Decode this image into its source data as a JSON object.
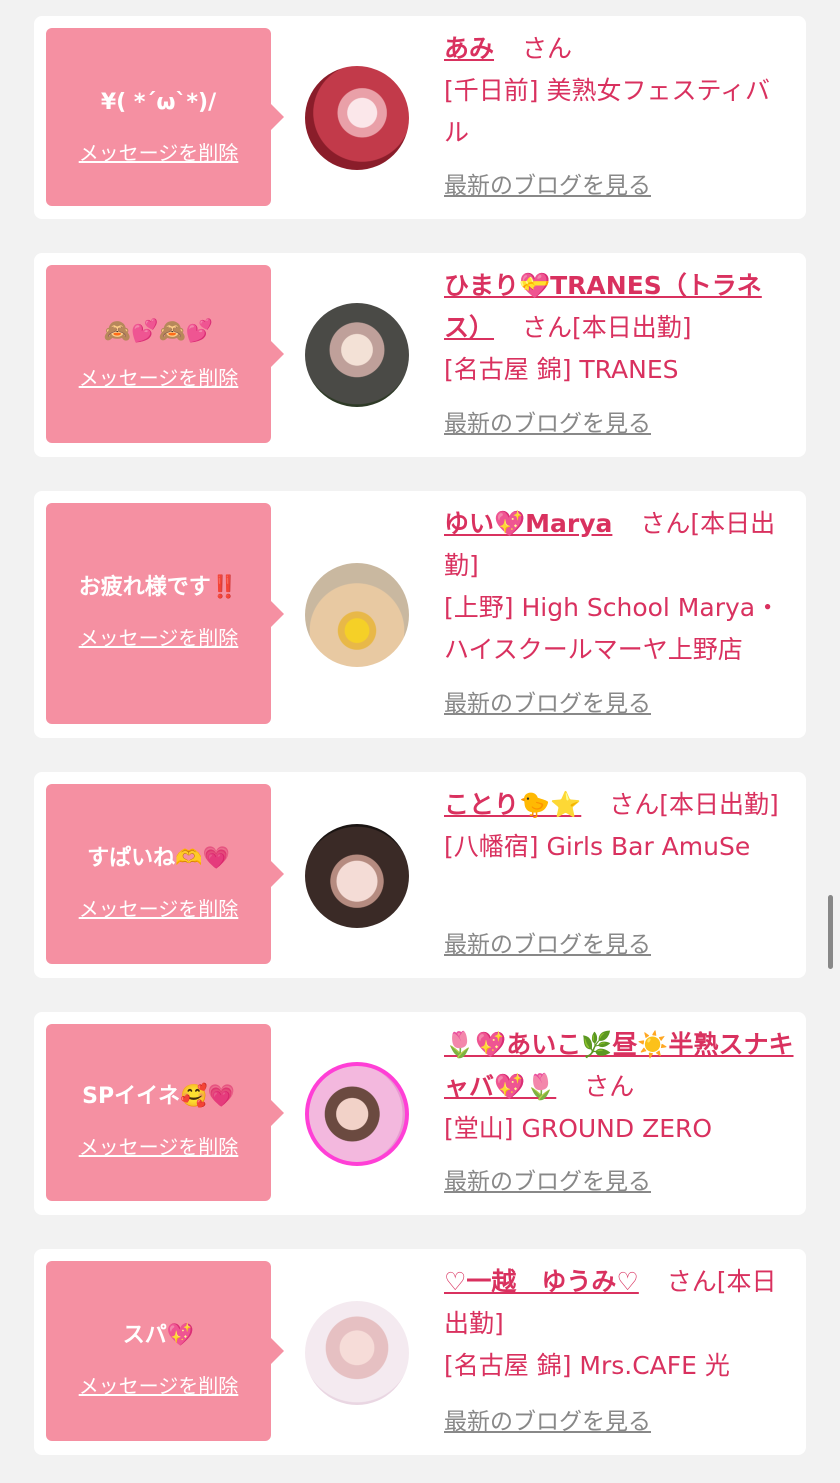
{
  "cards": [
    {
      "message": "¥( *´ω`*)/",
      "delete_label": "メッセージを削除",
      "name": "あみ",
      "honorific": "さん",
      "status": "",
      "shop": "[千日前] 美熟女フェスティバル",
      "blog_label": "最新のブログを見る"
    },
    {
      "message": "🙈💕🙈💕",
      "delete_label": "メッセージを削除",
      "name": "ひまり💝TRANES（トラネス）",
      "honorific": "さん",
      "status": "[本日出勤]",
      "shop": "[名古屋 錦] TRANES",
      "blog_label": "最新のブログを見る"
    },
    {
      "message": "お疲れ様です‼️",
      "delete_label": "メッセージを削除",
      "name": "ゆい💖Marya",
      "honorific": "さん",
      "status": "[本日出勤]",
      "shop": "[上野] High School Marya・ハイスクールマーヤ上野店",
      "blog_label": "最新のブログを見る"
    },
    {
      "message": "すぱいね🫶💗",
      "delete_label": "メッセージを削除",
      "name": "ことり🐤⭐️",
      "honorific": "さん",
      "status": "[本日出勤]",
      "shop": "[八幡宿] Girls Bar AmuSe",
      "blog_label": "最新のブログを見る"
    },
    {
      "message": "SPイイネ🥰💗",
      "delete_label": "メッセージを削除",
      "name": "🌷💖あいこ🌿昼☀️半熟スナキャバ💖🌷",
      "honorific": "さん",
      "status": "",
      "shop": "[堂山] GROUND ZERO",
      "blog_label": "最新のブログを見る"
    },
    {
      "message": "スパ💖",
      "delete_label": "メッセージを削除",
      "name": "♡一越　ゆうみ♡",
      "honorific": "さん",
      "status": "[本日出勤]",
      "shop": "[名古屋 錦] Mrs.CAFE 光",
      "blog_label": "最新のブログを見る"
    }
  ],
  "colors": {
    "accent": "#d9315f",
    "bubble": "#f590a2",
    "page_bg": "#f2f2f2",
    "muted_link": "#888888"
  }
}
